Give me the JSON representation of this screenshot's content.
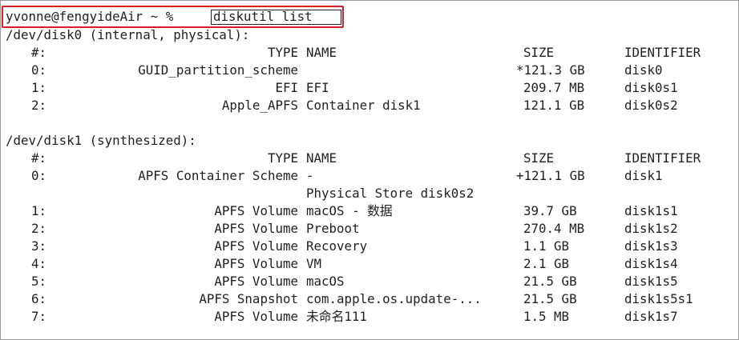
{
  "prompt": {
    "text": "yvonne@fengyideAir ~ %",
    "command": "diskutil list"
  },
  "headers": {
    "num": "#:",
    "type": "TYPE",
    "name": "NAME",
    "size": "SIZE",
    "identifier": "IDENTIFIER"
  },
  "disk0": {
    "title": "/dev/disk0 (internal, physical):",
    "rows": [
      {
        "num": "0:",
        "type": "GUID_partition_scheme",
        "name": "",
        "size": "*121.3 GB",
        "id": "disk0"
      },
      {
        "num": "1:",
        "type": "EFI",
        "name": "EFI",
        "size": "209.7 MB",
        "id": "disk0s1"
      },
      {
        "num": "2:",
        "type": "Apple_APFS",
        "name": "Container disk1",
        "size": "121.1 GB",
        "id": "disk0s2"
      }
    ]
  },
  "disk1": {
    "title": "/dev/disk1 (synthesized):",
    "rows": [
      {
        "num": "0:",
        "type": "APFS Container Scheme",
        "name": "-",
        "size": "+121.1 GB",
        "id": "disk1"
      },
      {
        "num": "",
        "type": "",
        "name": "Physical Store disk0s2",
        "size": "",
        "id": ""
      },
      {
        "num": "1:",
        "type": "APFS Volume",
        "name": "macOS - 数据",
        "size": "39.7 GB",
        "id": "disk1s1"
      },
      {
        "num": "2:",
        "type": "APFS Volume",
        "name": "Preboot",
        "size": "270.4 MB",
        "id": "disk1s2"
      },
      {
        "num": "3:",
        "type": "APFS Volume",
        "name": "Recovery",
        "size": "1.1 GB",
        "id": "disk1s3"
      },
      {
        "num": "4:",
        "type": "APFS Volume",
        "name": "VM",
        "size": "2.1 GB",
        "id": "disk1s4"
      },
      {
        "num": "5:",
        "type": "APFS Volume",
        "name": "macOS",
        "size": "21.5 GB",
        "id": "disk1s5"
      },
      {
        "num": "6:",
        "type": "APFS Snapshot",
        "name": "com.apple.os.update-...",
        "size": "21.5 GB",
        "id": "disk1s5s1"
      },
      {
        "num": "7:",
        "type": "APFS Volume",
        "name": "未命名111",
        "size": "1.5 MB",
        "id": "disk1s7"
      }
    ]
  },
  "colors": {
    "highlight": "#d81f26",
    "text": "#1f1f1f",
    "background": "#ffffff"
  }
}
